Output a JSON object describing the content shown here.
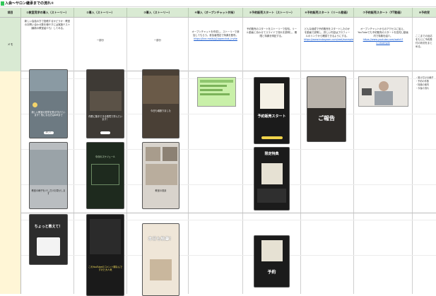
{
  "sheet": {
    "title": "入会〜サロン継承までの流れ①"
  },
  "columns": [
    {
      "id": "label",
      "header": "項目"
    },
    {
      "id": "c1",
      "header": "①教室見学の導入（ストーリー）"
    },
    {
      "id": "c2",
      "header": "②導入（ストーリー）"
    },
    {
      "id": "c3",
      "header": "③導入（ストーリー）"
    },
    {
      "id": "c4",
      "header": "④導入（オープンチャット共有）"
    },
    {
      "id": "c5",
      "header": "⑤予約販売スタート（ストーリー）"
    },
    {
      "id": "c6",
      "header": "⑥予約販売スタート（リール動画）"
    },
    {
      "id": "c7",
      "header": "⑦予約販売スタート（YT動画）"
    },
    {
      "id": "c8",
      "header": "⑧予約受"
    }
  ],
  "memo_row": {
    "label": "メモ",
    "cells": [
      "新しい会話の方で投稿するかどうか・教室のお問い合わせ数を増やすには実施テスト（最新の教室紹介も）してみる。",
      "一部分",
      "一部分",
      "オープンチャットを作成し、ストーリーで参加してもらう。参加者限定で特典を配布。",
      "予約販売のスタートをストーリーで告知。リール動画とあわせてスライドで流れを説明し、期限と特典を明記する。",
      "どんな経緯で予約販売をスタートしたのかを動画で説明し、詳しい内容はプロフィールのリンクから確認できるようにする。",
      "オープンチャットからのアクセスに加え、YouTubeでも予約販売のスタートを告知し動画内で特典を紹介。",
      "ここまでの反応をもとに予約受付の状況をまとめる。"
    ],
    "link_text": "https://line.me/ti/g2/openchat_invite",
    "link_text_2": "https://www.instagram.com/reel/example",
    "link_text_3": "https://www.youtube.com/watch?v=example"
  },
  "stories": {
    "c1": [
      {
        "caption": "新しい教室の見学を受け付けています！気になる方はDMまで",
        "pill": "詳しく"
      },
      {
        "caption": "教室の様子を少しだけお見せします",
        "pill": ""
      },
      {
        "caption": "ちょっと教えて！",
        "pill": ""
      }
    ],
    "c2": [
      {
        "caption": "作業に集中できる環境で学んでいます！",
        "pill": ""
      },
      {
        "caption": "今月のスケジュール",
        "pill": ""
      },
      {
        "caption": "これYouTubeのコメント欄なんですけど大人気",
        "pill": ""
      }
    ],
    "c3": [
      {
        "caption": "今日も頑張りました",
        "pill": ""
      },
      {
        "caption": "教室の風景",
        "pill": ""
      },
      {
        "caption": "本日も執筆！",
        "pill": ""
      }
    ],
    "c5": [
      {
        "caption": "予約販売スタート",
        "pill": ""
      },
      {
        "caption": "限定特典",
        "pill": ""
      },
      {
        "caption": "予約",
        "pill": ""
      }
    ],
    "c6": [
      {
        "caption": "ご報告",
        "pill": ""
      }
    ]
  },
  "c8_list": [
    "・受け付けの様子",
    "・予約の件数",
    "・特典の案内",
    "・今後の流れ"
  ],
  "colors": {
    "header_bg": "#d9ead3",
    "label_bg": "#fff6d6",
    "accent": "#34c759",
    "memo_highlight": "#c9f0a9"
  },
  "icons": [
    "sheet-icon"
  ]
}
